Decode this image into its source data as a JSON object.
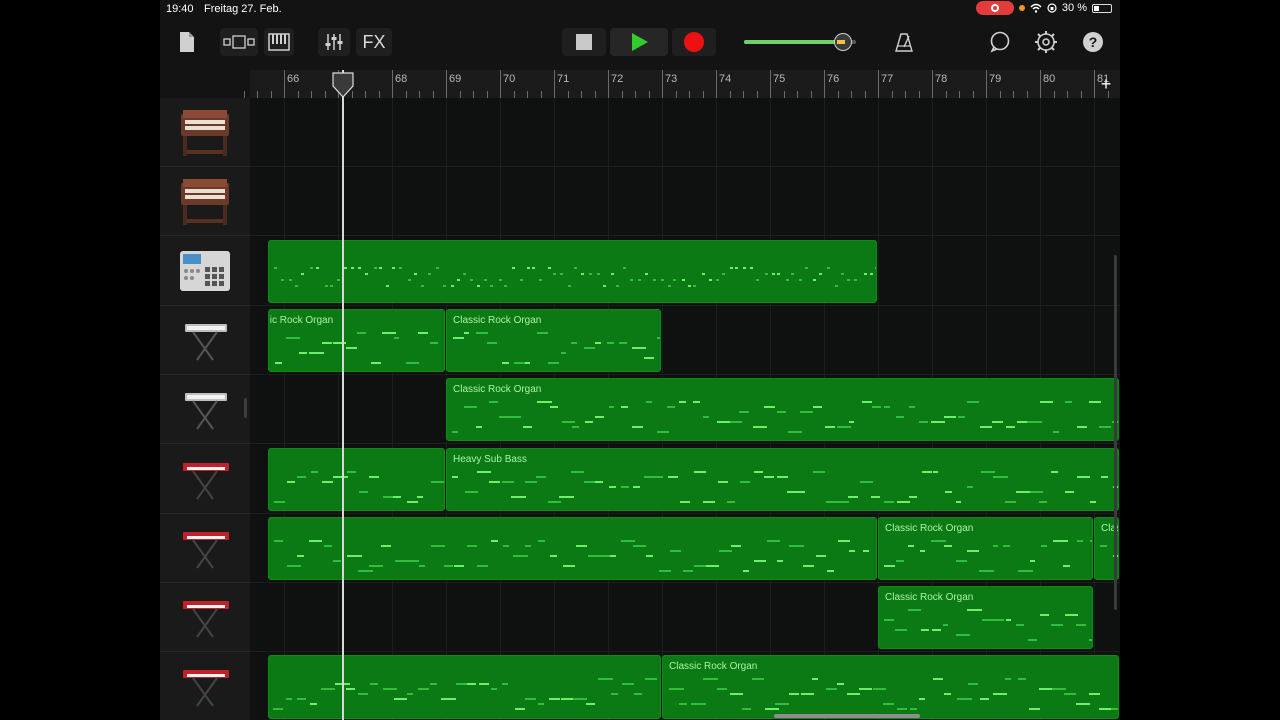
{
  "status_bar": {
    "time": "19:40",
    "date": "Freitag 27. Feb.",
    "battery": "30 %"
  },
  "toolbar": {
    "fx_label": "FX",
    "icons": [
      "my-songs-icon",
      "view-toggle-icon",
      "keyboard-icon",
      "mixer-icon",
      "fx-button",
      "stop-icon",
      "play-icon",
      "record-icon",
      "master-volume",
      "metronome-icon",
      "loop-browser-icon",
      "settings-icon",
      "help-icon"
    ],
    "master_volume_level": 0.88,
    "colors": {
      "play": "#33cc2f",
      "record": "#ee1111",
      "accent_green": "#6fd16a"
    }
  },
  "ruler": {
    "bars": [
      "66",
      "67",
      "68",
      "69",
      "70",
      "71",
      "72",
      "73",
      "74",
      "75",
      "76",
      "77",
      "78",
      "79",
      "80",
      "81"
    ],
    "current_bar": "67",
    "add_label": "+"
  },
  "tracks": [
    {
      "instrument": "organ-icon",
      "regions": []
    },
    {
      "instrument": "organ-icon",
      "regions": []
    },
    {
      "instrument": "drum-machine-icon",
      "regions": [
        {
          "name": "",
          "start": 65.7,
          "end": 77
        }
      ]
    },
    {
      "instrument": "keyboard-stand-icon",
      "regions": [
        {
          "name": "ic Rock Organ",
          "start": 65.7,
          "end": 69
        },
        {
          "name": "Classic Rock Organ",
          "start": 69,
          "end": 73
        }
      ]
    },
    {
      "instrument": "keyboard-stand-icon",
      "regions": [
        {
          "name": "Classic Rock Organ",
          "start": 69,
          "end": 81.7
        }
      ]
    },
    {
      "instrument": "red-synth-icon",
      "regions": [
        {
          "name": "",
          "start": 65.7,
          "end": 69
        },
        {
          "name": "Heavy Sub Bass",
          "start": 69,
          "end": 81.7
        }
      ]
    },
    {
      "instrument": "red-synth-icon",
      "regions": [
        {
          "name": "",
          "start": 65.7,
          "end": 77
        },
        {
          "name": "Classic Rock Organ",
          "start": 77,
          "end": 81
        },
        {
          "name": "Classic",
          "start": 81,
          "end": 81.7
        }
      ]
    },
    {
      "instrument": "red-synth-icon",
      "regions": [
        {
          "name": "Classic Rock Organ",
          "start": 77,
          "end": 81
        }
      ]
    },
    {
      "instrument": "red-synth-icon",
      "regions": [
        {
          "name": "",
          "start": 65.7,
          "end": 73
        },
        {
          "name": "Classic Rock Organ",
          "start": 73,
          "end": 81.7
        }
      ]
    }
  ]
}
